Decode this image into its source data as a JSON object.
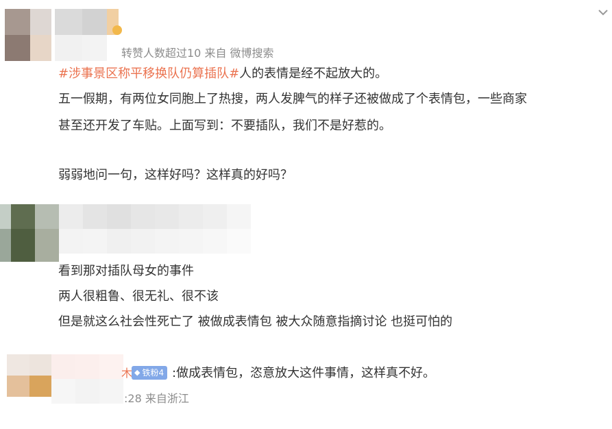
{
  "ui": {
    "collapse_icon": "chevron-down-icon"
  },
  "post1": {
    "meta": "转赞人数超过10  来自 微博搜索",
    "hashtag": "#涉事景区称平移换队仍算插队#",
    "line1_rest": "人的表情是经不起放大的。",
    "line2": "五一假期，有两位女同胞上了热搜，两人发脾气的样子还被做成了个表情包，一些商家",
    "line3": "甚至还开发了车贴。上面写到：不要插队，我们不是好惹的。",
    "line4": "弱弱地问一句，这样好吗？这样真的好吗？"
  },
  "post2": {
    "line1": "看到那对插队母女的事件",
    "line2": "两人很粗鲁、很无礼、很不该",
    "line3": "但是就这么社会性死亡了 被做成表情包 被大众随意指摘讨论 也挺可怕的"
  },
  "reply": {
    "name_tail": "木",
    "badge": "铁粉4",
    "badge_icon": "diamond-icon",
    "text": ":做成表情包，恣意放大这件事情，这样真不好。",
    "meta": ":28 来自浙江"
  },
  "colors": {
    "hashtag": "#eb7350",
    "badge_bg": "#82a8e8",
    "meta_text": "#8c8c8c",
    "body_text": "#333333"
  }
}
